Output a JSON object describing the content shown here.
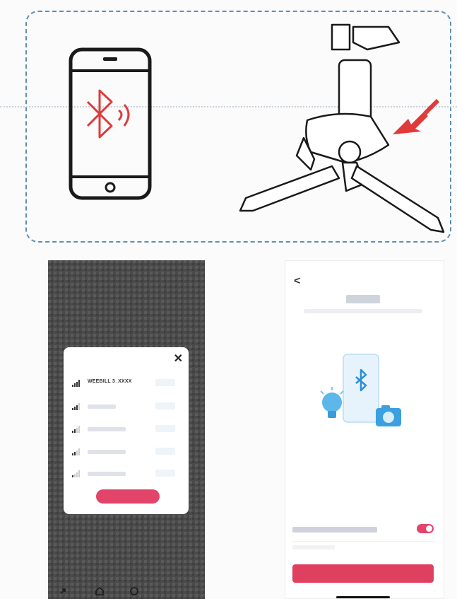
{
  "colors": {
    "dashed_border": "#5f8fb8",
    "bluetooth_red": "#e03a3a",
    "accent": "#e3446a",
    "dark_bg": "#4a4a4a",
    "illus_blue": "#3aa0e0"
  },
  "top_panel": {
    "phone_icon": "smartphone-bluetooth-icon",
    "gimbal_icon": "gimbal-tripod-illustration",
    "arrow_icon": "red-arrow-icon"
  },
  "device_dialog": {
    "close_icon": "close-icon",
    "devices": [
      {
        "label": "WEEBILL 3_XXXX",
        "signal": 4
      },
      {
        "label": "",
        "signal": 3
      },
      {
        "label": "",
        "signal": 2
      },
      {
        "label": "",
        "signal": 2
      },
      {
        "label": "",
        "signal": 1
      }
    ]
  },
  "app_screen": {
    "back_icon": "back-arrow-icon",
    "back_glyph": "<",
    "illustration": "bluetooth-pairing-illustration",
    "toggle_on": true
  }
}
